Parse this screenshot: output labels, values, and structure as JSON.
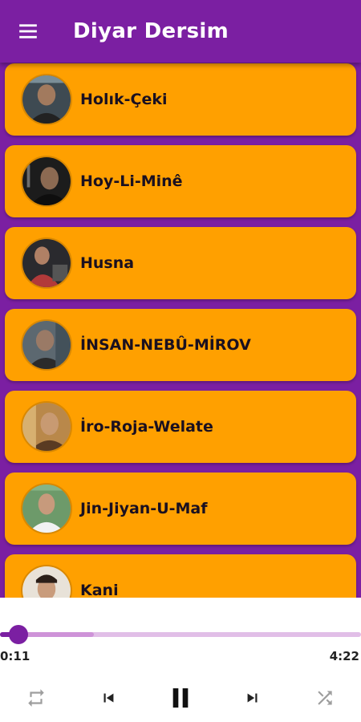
{
  "app": {
    "title": "Diyar Dersim",
    "primary_color": "#7b1fa2",
    "card_color": "#ffa000"
  },
  "icons": {
    "menu": "hamburger-menu-icon",
    "repeat": "repeat-icon",
    "previous": "skip-previous-icon",
    "pause": "pause-icon",
    "next": "skip-next-icon",
    "shuffle": "shuffle-icon"
  },
  "songs": [
    {
      "title": "Holık-Çeki"
    },
    {
      "title": "Hoy-Li-Minê"
    },
    {
      "title": "Husna"
    },
    {
      "title": "İNSAN-NEBÛ-MİROV"
    },
    {
      "title": "İro-Roja-Welate"
    },
    {
      "title": "Jin-Jiyan-U-Maf"
    },
    {
      "title": "Kani"
    }
  ],
  "player": {
    "current_time": "0:11",
    "duration": "4:22",
    "progress_fraction": 0.05,
    "buffered_fraction": 0.26
  }
}
